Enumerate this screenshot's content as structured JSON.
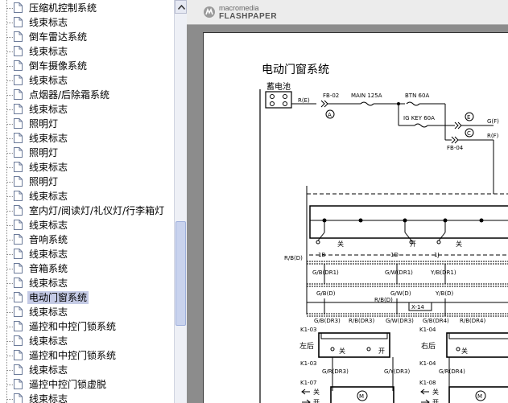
{
  "tree": {
    "items": [
      {
        "label": "压缩机控制系统",
        "selected": false
      },
      {
        "label": "线束标志",
        "selected": false
      },
      {
        "label": "倒车雷达系统",
        "selected": false
      },
      {
        "label": "线束标志",
        "selected": false
      },
      {
        "label": "倒车摄像系统",
        "selected": false
      },
      {
        "label": "线束标志",
        "selected": false
      },
      {
        "label": "点烟器/后除霜系统",
        "selected": false
      },
      {
        "label": "线束标志",
        "selected": false
      },
      {
        "label": "照明灯",
        "selected": false
      },
      {
        "label": "线束标志",
        "selected": false
      },
      {
        "label": "照明灯",
        "selected": false
      },
      {
        "label": "线束标志",
        "selected": false
      },
      {
        "label": "照明灯",
        "selected": false
      },
      {
        "label": "线束标志",
        "selected": false
      },
      {
        "label": "室内灯/阅读灯/礼仪灯/行李箱灯",
        "selected": false
      },
      {
        "label": "线束标志",
        "selected": false
      },
      {
        "label": "音响系统",
        "selected": false
      },
      {
        "label": "线束标志",
        "selected": false
      },
      {
        "label": "音箱系统",
        "selected": false
      },
      {
        "label": "线束标志",
        "selected": false
      },
      {
        "label": "电动门窗系统",
        "selected": true
      },
      {
        "label": "线束标志",
        "selected": false
      },
      {
        "label": "遥控和中控门锁系统",
        "selected": false
      },
      {
        "label": "线束标志",
        "selected": false
      },
      {
        "label": "遥控和中控门锁系统",
        "selected": false
      },
      {
        "label": "线束标志",
        "selected": false
      },
      {
        "label": "遥控中控门锁虚脱",
        "selected": false
      },
      {
        "label": "线束标志",
        "selected": false
      }
    ]
  },
  "viewer": {
    "logo_line1": "macromedia",
    "logo_line2": "FLASHPAPER"
  },
  "doc": {
    "title": "电动门窗系统",
    "battery": "蓄电池",
    "wire_re": "R(E)",
    "fb02": "FB-02",
    "main": "MAIN 125A",
    "btn": "BTN 60A",
    "igkey": "IG KEY 60A",
    "circle_a": "A",
    "circle_e": "E",
    "circle_c": "C",
    "gf": "G(F)",
    "rf": "R(F)",
    "fb04": "FB-04",
    "rbd": "R/B(D)",
    "t1b": "1B",
    "t1d": "1D",
    "t1j": "1J",
    "guan1": "关",
    "kai1": "开",
    "guan2": "关",
    "gbdr1": "G/B(DR1)",
    "gwdr1": "G/W(DR1)",
    "ybdr1": "Y/B(DR1)",
    "y_cut": "Y",
    "gbd": "G/B(D)",
    "gwd": "G/W(D)",
    "ybd": "Y/B(D)",
    "rbd2": "R/B(D)",
    "x14": "X-14",
    "gbdr3": "G/B(DR3)",
    "rbdr3": "R/B(DR3)",
    "gwdr3": "G/W(DR3)",
    "gbdr4": "G/B(DR4)",
    "rbdr4": "R/B(DR4)",
    "k103": "K1-03",
    "k104": "K1-04",
    "zuohou": "左后",
    "youhou": "右后",
    "guan3": "关",
    "kai3": "开",
    "guan4": "关",
    "grdr3": "G/R(DR3)",
    "gydr3": "G/Y(DR3)",
    "grdr4": "G/R(DR4)",
    "k103b": "K1-03",
    "k104b": "K1-04",
    "k107": "K1-07",
    "k108": "K1-08",
    "guan5": "关",
    "kai5": "开",
    "guan6": "关",
    "kai6": "开",
    "motor": "M",
    "e_cut": "E"
  }
}
